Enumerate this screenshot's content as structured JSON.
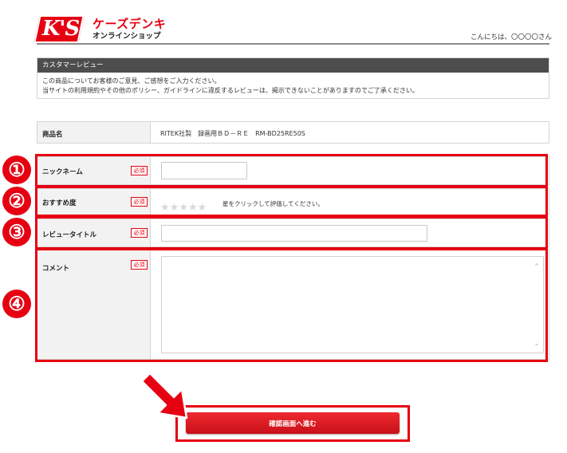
{
  "header": {
    "logo_badge": "K'S",
    "logo_name": "ケーズデンキ",
    "logo_sub": "オンラインショップ",
    "greeting": "こんにちは、〇〇〇〇さん"
  },
  "notice": {
    "title": "カスタマーレビュー",
    "line1": "この商品についてお客様のご意見、ご感想をご入力ください。",
    "line2": "当サイトの利用規約やその他のポリシー、ガイドラインに違反するレビューは、掲示できないことがありますのでご了承ください。"
  },
  "form": {
    "product": {
      "label": "商品名",
      "value": "RITEK社製　録画用ＢＤ－ＲＥ　RM-BD25RE50S"
    },
    "required_badge": "必須",
    "nickname": {
      "label": "ニックネーム",
      "value": "",
      "placeholder": ""
    },
    "rating": {
      "label": "おすすめ度",
      "value": 0,
      "max": 5,
      "hint": "星をクリックして評価してください。"
    },
    "review_title": {
      "label": "レビュータイトル",
      "value": "",
      "placeholder": ""
    },
    "comment": {
      "label": "コメント",
      "value": "",
      "placeholder": ""
    }
  },
  "annotations": [
    "①",
    "②",
    "③",
    "④"
  ],
  "submit": {
    "label": "確認画面へ進む"
  },
  "colors": {
    "accent": "#e60012",
    "header_bar": "#4d4d4d",
    "label_bg": "#f2f2f2",
    "star_empty": "#d9d9d9"
  }
}
